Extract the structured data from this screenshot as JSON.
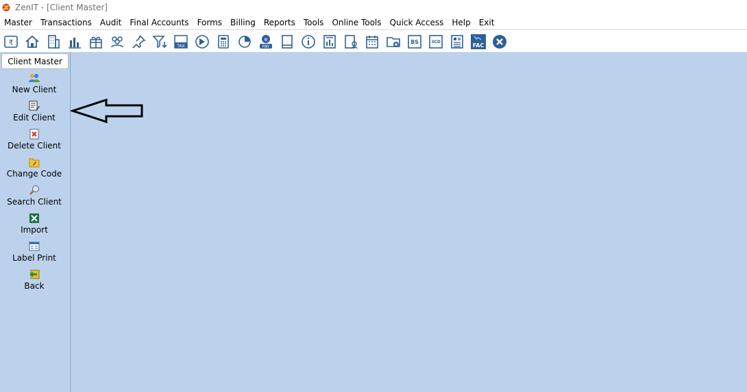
{
  "window": {
    "title": "ZenIT - [Client Master]"
  },
  "menu": {
    "items": [
      {
        "label": "Master"
      },
      {
        "label": "Transactions"
      },
      {
        "label": "Audit"
      },
      {
        "label": "Final Accounts"
      },
      {
        "label": "Forms"
      },
      {
        "label": "Billing"
      },
      {
        "label": "Reports"
      },
      {
        "label": "Tools"
      },
      {
        "label": "Online Tools"
      },
      {
        "label": "Quick Access"
      },
      {
        "label": "Help"
      },
      {
        "label": "Exit"
      }
    ]
  },
  "toolbar": {
    "buttons": [
      {
        "icon": "rupee-book-icon"
      },
      {
        "icon": "home-icon"
      },
      {
        "icon": "building-icon"
      },
      {
        "icon": "bar-chart-icon"
      },
      {
        "icon": "gift-icon"
      },
      {
        "icon": "group-icon"
      },
      {
        "icon": "pin-icon"
      },
      {
        "icon": "filter-icon"
      },
      {
        "icon": "tax-icon"
      },
      {
        "icon": "disc-icon"
      },
      {
        "icon": "calculator-icon"
      },
      {
        "icon": "pie-icon"
      },
      {
        "icon": "e-pay-icon"
      },
      {
        "icon": "book-icon"
      },
      {
        "icon": "info-icon"
      },
      {
        "icon": "report-chart-icon"
      },
      {
        "icon": "user-doc-icon"
      },
      {
        "icon": "calendar-icon"
      },
      {
        "icon": "folder-add-icon"
      },
      {
        "icon": "bs-icon"
      },
      {
        "icon": "3cd-icon"
      },
      {
        "icon": "ledger-icon"
      },
      {
        "icon": "fac-icon"
      },
      {
        "icon": "close-circle-icon"
      }
    ],
    "labels": {
      "tax": "TAX",
      "pay": "PAY",
      "bs": "BS",
      "cd": "3CD",
      "fac": "FAC"
    }
  },
  "sidebar": {
    "header": "Client Master",
    "items": [
      {
        "label": "New Client",
        "icon": "users-icon"
      },
      {
        "label": "Edit Client",
        "icon": "edit-icon"
      },
      {
        "label": "Delete Client",
        "icon": "delete-icon"
      },
      {
        "label": "Change Code",
        "icon": "change-code-icon"
      },
      {
        "label": "Search Client",
        "icon": "search-icon"
      },
      {
        "label": "Import",
        "icon": "excel-icon"
      },
      {
        "label": "Label Print",
        "icon": "label-icon"
      },
      {
        "label": "Back",
        "icon": "back-icon"
      }
    ]
  },
  "colors": {
    "background": "#bcd2ec",
    "accent": "#2f5f97"
  }
}
